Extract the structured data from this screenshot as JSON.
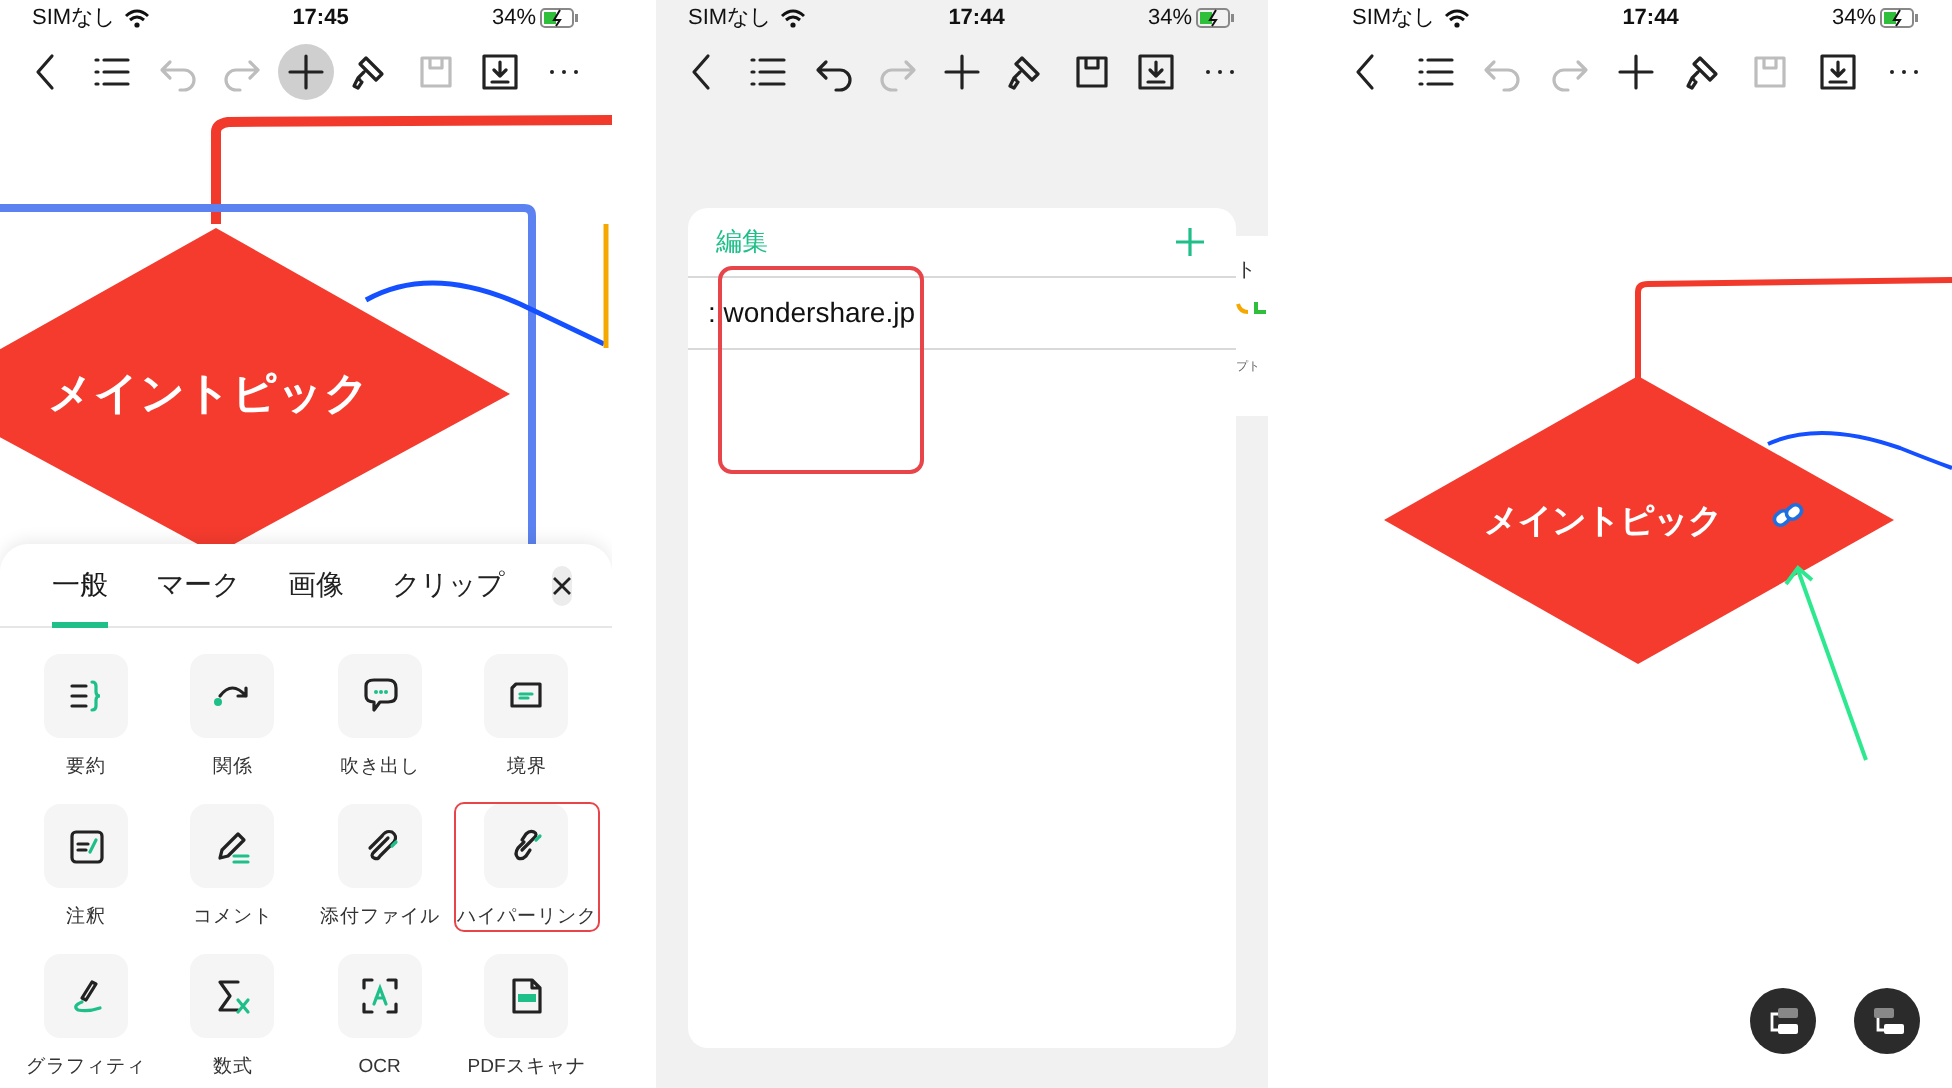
{
  "screens": [
    {
      "kind": "editor_sheet",
      "status_bar": {
        "carrier": "SIMなし",
        "time": "17:45",
        "battery": "34%"
      },
      "toolbar": [
        {
          "kind": "back",
          "disabled": false,
          "selected": false
        },
        {
          "kind": "outline",
          "disabled": false,
          "selected": false
        },
        {
          "kind": "undo",
          "disabled": true,
          "selected": false
        },
        {
          "kind": "redo",
          "disabled": true,
          "selected": false
        },
        {
          "kind": "add",
          "disabled": false,
          "selected": true
        },
        {
          "kind": "format",
          "disabled": false,
          "selected": false
        },
        {
          "kind": "save",
          "disabled": true,
          "selected": false
        },
        {
          "kind": "export",
          "disabled": false,
          "selected": false
        },
        {
          "kind": "more",
          "disabled": false,
          "selected": false
        }
      ],
      "canvas": {
        "topic": "メイントピック"
      },
      "sheet": {
        "tabs": [
          {
            "label": "一般",
            "selected": true
          },
          {
            "label": "マーク",
            "selected": false
          },
          {
            "label": "画像",
            "selected": false
          },
          {
            "label": "クリップ",
            "selected": false
          }
        ],
        "items": [
          {
            "kind": "summary",
            "label": "要約",
            "highlighted": false
          },
          {
            "kind": "relation",
            "label": "関係",
            "highlighted": false
          },
          {
            "kind": "callout",
            "label": "吹き出し",
            "highlighted": false
          },
          {
            "kind": "boundary",
            "label": "境界",
            "highlighted": false
          },
          {
            "kind": "note",
            "label": "注釈",
            "highlighted": false
          },
          {
            "kind": "comment",
            "label": "コメント",
            "highlighted": false
          },
          {
            "kind": "attachment",
            "label": "添付ファイル",
            "highlighted": false
          },
          {
            "kind": "hyperlink",
            "label": "ハイパーリンク",
            "highlighted": true
          },
          {
            "kind": "graffiti",
            "label": "グラフィティ",
            "highlighted": false
          },
          {
            "kind": "formula",
            "label": "数式",
            "highlighted": false
          },
          {
            "kind": "ocr",
            "label": "OCR",
            "highlighted": false
          },
          {
            "kind": "pdf",
            "label": "PDFスキャナ",
            "highlighted": false
          }
        ]
      }
    },
    {
      "kind": "link_editor",
      "status_bar": {
        "carrier": "SIMなし",
        "time": "17:44",
        "battery": "34%"
      },
      "toolbar": [
        {
          "kind": "back",
          "disabled": false,
          "selected": false
        },
        {
          "kind": "outline",
          "disabled": false,
          "selected": false
        },
        {
          "kind": "undo",
          "disabled": false,
          "selected": false
        },
        {
          "kind": "redo",
          "disabled": true,
          "selected": false
        },
        {
          "kind": "add",
          "disabled": false,
          "selected": false
        },
        {
          "kind": "format",
          "disabled": false,
          "selected": false
        },
        {
          "kind": "save",
          "disabled": false,
          "selected": false
        },
        {
          "kind": "export",
          "disabled": false,
          "selected": false
        },
        {
          "kind": "more",
          "disabled": false,
          "selected": false
        }
      ],
      "dialog": {
        "title": "編集",
        "link": ": wondershare.jp",
        "highlighted": true
      },
      "behind": {
        "title": "ト",
        "caption": "プト"
      }
    },
    {
      "kind": "canvas_link",
      "status_bar": {
        "carrier": "SIMなし",
        "time": "17:44",
        "battery": "34%"
      },
      "toolbar": [
        {
          "kind": "back",
          "disabled": false,
          "selected": false
        },
        {
          "kind": "outline",
          "disabled": false,
          "selected": false
        },
        {
          "kind": "undo",
          "disabled": true,
          "selected": false
        },
        {
          "kind": "redo",
          "disabled": true,
          "selected": false
        },
        {
          "kind": "add",
          "disabled": false,
          "selected": false
        },
        {
          "kind": "format",
          "disabled": false,
          "selected": false
        },
        {
          "kind": "save",
          "disabled": true,
          "selected": false
        },
        {
          "kind": "export",
          "disabled": false,
          "selected": false
        },
        {
          "kind": "more",
          "disabled": false,
          "selected": false
        }
      ],
      "canvas": {
        "topic": "メイントピック",
        "has_link": true
      }
    }
  ]
}
